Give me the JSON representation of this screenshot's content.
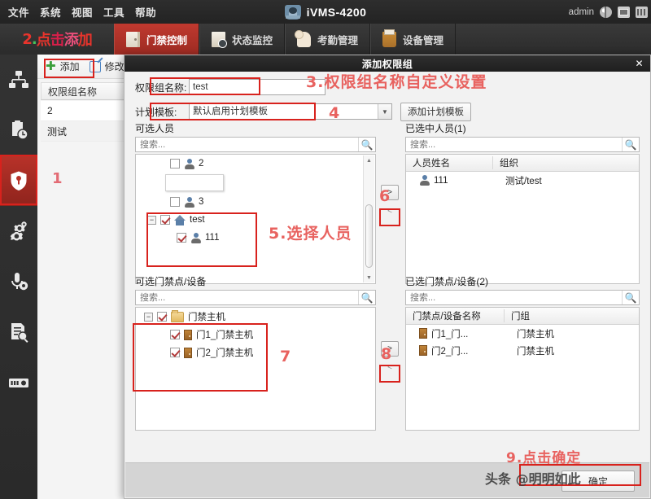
{
  "titlebar": {
    "menu": [
      {
        "label": "文件",
        "name": "menu-file"
      },
      {
        "label": "系统",
        "name": "menu-system"
      },
      {
        "label": "视图",
        "name": "menu-view"
      },
      {
        "label": "工具",
        "name": "menu-tools"
      },
      {
        "label": "帮助",
        "name": "menu-help"
      }
    ],
    "app_title": "iVMS-4200",
    "user": "admin",
    "icons": [
      "globe-icon",
      "picture-icon",
      "grid-icon"
    ]
  },
  "tabbar": {
    "annotation": {
      "num": "2",
      "text": ".点击添加",
      "chars": [
        "2",
        ".",
        "点",
        "击",
        "添",
        "加"
      ]
    },
    "tabs": [
      {
        "label": "门禁控制",
        "icon": "door-control-icon",
        "active": true
      },
      {
        "label": "状态监控",
        "icon": "status-monitor-icon",
        "active": false
      },
      {
        "label": "考勤管理",
        "icon": "attendance-icon",
        "active": false
      },
      {
        "label": "设备管理",
        "icon": "device-manage-icon",
        "active": false
      }
    ]
  },
  "sidebar": {
    "items": [
      {
        "name": "sidebar-item-organization",
        "icon": "org-chart-icon",
        "active": false
      },
      {
        "name": "sidebar-item-schedule",
        "icon": "clipboard-clock-icon",
        "active": false
      },
      {
        "name": "sidebar-item-permission",
        "icon": "shield-key-icon",
        "active": true
      },
      {
        "name": "sidebar-item-settings",
        "icon": "gears-icon",
        "active": false
      },
      {
        "name": "sidebar-item-audio",
        "icon": "microphone-icon",
        "active": false
      },
      {
        "name": "sidebar-item-records",
        "icon": "document-search-icon",
        "active": false
      },
      {
        "name": "sidebar-item-reader",
        "icon": "card-reader-icon",
        "active": false
      }
    ]
  },
  "workarea": {
    "toolbar": {
      "add_label": "添加",
      "edit_label": "修改"
    },
    "table": {
      "header": "权限组名称",
      "rows": [
        "2",
        "测试"
      ]
    },
    "annotation_1": "1"
  },
  "dialog": {
    "title": "添加权限组",
    "close": "✕",
    "group_name": {
      "label": "权限组名称:",
      "value": "test"
    },
    "template": {
      "label": "计划模板:",
      "value": "默认启用计划模板",
      "arrow": "▼",
      "add_button": "添加计划模板"
    },
    "available_persons": {
      "title": "可选人员",
      "search_placeholder": "搜索...",
      "search_icon": "search-icon",
      "tree": [
        {
          "label": "2",
          "icon": "person-icon",
          "checked": false,
          "indent": 1,
          "expander": null
        },
        {
          "label": "",
          "icon": "blank-item",
          "checked": false,
          "indent": 2,
          "expander": null
        },
        {
          "label": "3",
          "icon": "person-icon",
          "checked": false,
          "indent": 1,
          "expander": null
        },
        {
          "label": "test",
          "icon": "home-icon",
          "checked": true,
          "indent": 0,
          "expander": "−"
        },
        {
          "label": "111",
          "icon": "person-icon",
          "checked": true,
          "indent": 1,
          "expander": null
        }
      ]
    },
    "selected_persons": {
      "title": "已选中人员(1)",
      "search_placeholder": "搜索...",
      "columns": [
        "人员姓名",
        "组织"
      ],
      "rows": [
        {
          "name": "111",
          "org": "测试/test",
          "icon": "person-icon"
        }
      ]
    },
    "available_doors": {
      "title": "可选门禁点/设备",
      "search_placeholder": "搜索...",
      "tree": [
        {
          "label": "门禁主机",
          "icon": "folder-icon",
          "checked": true,
          "indent": 0,
          "expander": "−"
        },
        {
          "label": "门1_门禁主机",
          "icon": "door-icon",
          "checked": true,
          "indent": 1,
          "expander": null
        },
        {
          "label": "门2_门禁主机",
          "icon": "door-icon",
          "checked": true,
          "indent": 1,
          "expander": null
        }
      ]
    },
    "selected_doors": {
      "title": "已选门禁点/设备(2)",
      "search_placeholder": "搜索...",
      "columns": [
        "门禁点/设备名称",
        "门组"
      ],
      "rows": [
        {
          "name": "门1_门...",
          "group": "门禁主机",
          "icon": "door-icon"
        },
        {
          "name": "门2_门...",
          "group": "门禁主机",
          "icon": "door-icon"
        }
      ]
    },
    "transfer": {
      "to_right": ">",
      "to_left": "<"
    },
    "ok_button": "确定"
  },
  "annotations": {
    "a3": "3.权限组名称自定义设置",
    "a4": "4",
    "a5": "5.选择人员",
    "a6": "6",
    "a7": "7",
    "a8": "8",
    "a9": "9.点击确定"
  },
  "watermark": "头条 @明明如此",
  "colors": {
    "accent_red": "#b83229",
    "annotation_red": "#d8221d",
    "annotation_text": "#e8625f"
  }
}
